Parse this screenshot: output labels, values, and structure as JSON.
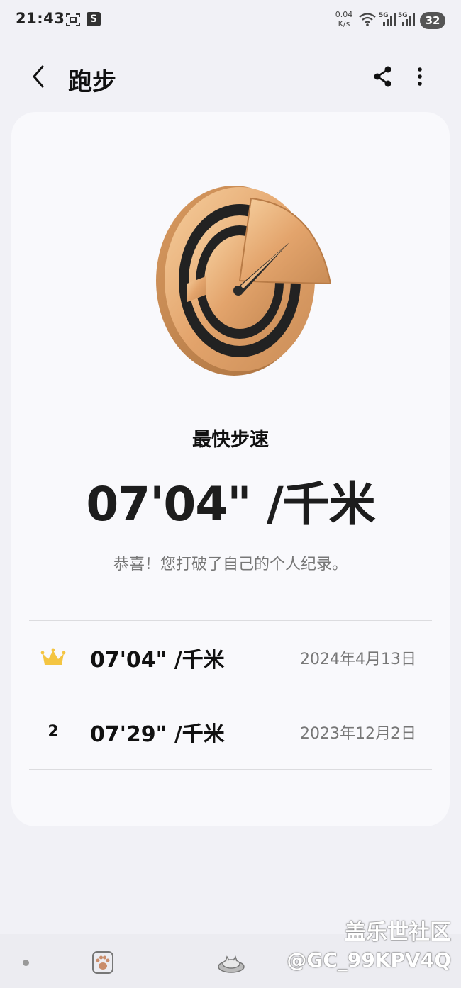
{
  "status_bar": {
    "time": "21:43",
    "s_badge": "S",
    "net_speed_value": "0.04",
    "net_speed_unit": "K/s",
    "battery": "32"
  },
  "header": {
    "title": "跑步",
    "back_icon": "chevron-left-icon",
    "share_icon": "share-icon",
    "more_icon": "more-vertical-icon"
  },
  "record": {
    "label": "最快步速",
    "value": "07'04\" /千米",
    "message": "恭喜！您打破了自己的个人纪录。",
    "medal_icon": "speedometer-medal-icon"
  },
  "ranking": [
    {
      "rank_icon": "crown-icon",
      "pace": "07'04\" /千米",
      "date": "2024年4月13日"
    },
    {
      "rank": "2",
      "pace": "07'29\" /千米",
      "date": "2023年12月2日"
    }
  ],
  "watermark": {
    "line1": "盖乐世社区",
    "line2": "@GC_99KPV4Q"
  },
  "colors": {
    "background": "#f1f1f6",
    "card": "#f9f9fc",
    "medal_gold": "#e8b07c",
    "medal_dark": "#222222",
    "crown": "#f4c542"
  }
}
